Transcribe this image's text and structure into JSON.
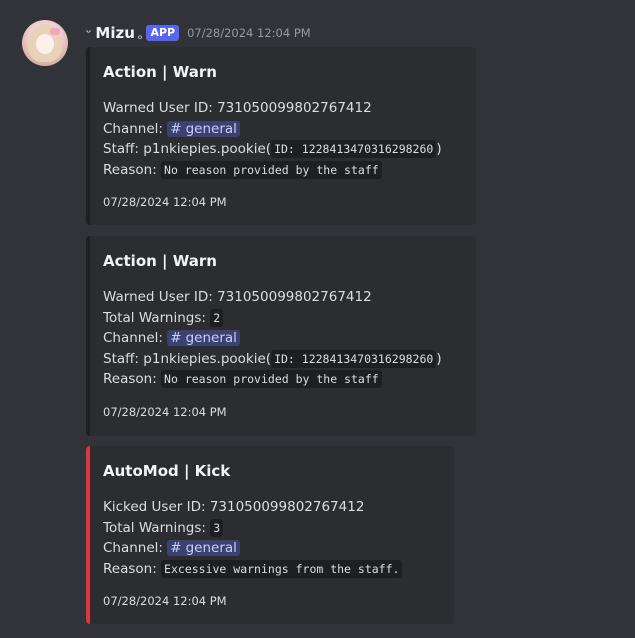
{
  "message": {
    "author": "Mizu",
    "prefix": "ᵕ",
    "suffix": "ₒ",
    "badge": "APP",
    "timestamp": "07/28/2024 12:04 PM"
  },
  "embeds": [
    {
      "title": "Action | Warn",
      "warned_label": "Warned User ID: ",
      "warned_id": "731050099802767412",
      "channel_label": "Channel: ",
      "channel": "general",
      "staff_label": "Staff: ",
      "staff_name": "p1nkiepies.pookie",
      "staff_id_code": "ID: 1228413470316298260",
      "reason_label": "Reason: ",
      "reason": "No reason provided by the staff",
      "footer": "07/28/2024 12:04 PM"
    },
    {
      "title": "Action | Warn",
      "warned_label": "Warned User ID: ",
      "warned_id": "731050099802767412",
      "warnings_label": "Total Warnings: ",
      "warnings": "2",
      "channel_label": "Channel: ",
      "channel": "general",
      "staff_label": "Staff: ",
      "staff_name": "p1nkiepies.pookie",
      "staff_id_code": "ID: 1228413470316298260",
      "reason_label": "Reason: ",
      "reason": "No reason provided by the staff",
      "footer": "07/28/2024 12:04 PM"
    },
    {
      "title": "AutoMod | Kick",
      "kicked_label": "Kicked User ID: ",
      "kicked_id": "731050099802767412",
      "warnings_label": "Total Warnings: ",
      "warnings": "3",
      "channel_label": "Channel: ",
      "channel": "general",
      "reason_label": "Reason: ",
      "reason": "Excessive warnings from the staff.",
      "footer": "07/28/2024 12:04 PM"
    }
  ],
  "colors": {
    "automod_accent": "#da373c",
    "embed_accent": "#1e1f22",
    "app_badge": "#5865f2"
  },
  "icons": {
    "channel": "hash-icon"
  }
}
